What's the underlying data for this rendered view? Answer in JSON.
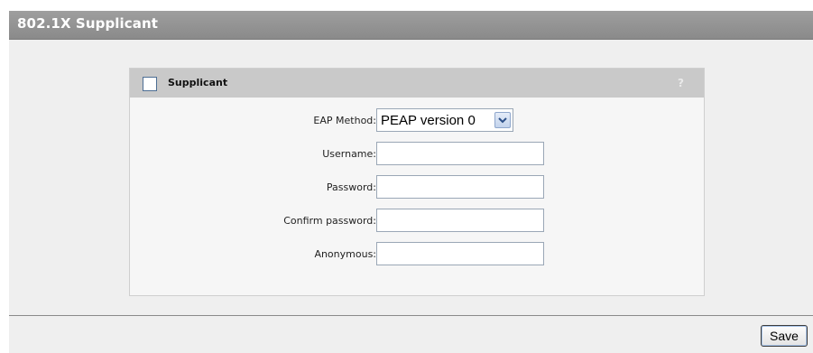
{
  "page": {
    "title": "802.1X Supplicant"
  },
  "panel": {
    "title": "Supplicant",
    "checkbox_checked": false,
    "help": "?",
    "fields": [
      {
        "label": "EAP Method:",
        "type": "select",
        "value": "PEAP version 0"
      },
      {
        "label": "Username:",
        "type": "text",
        "value": ""
      },
      {
        "label": "Password:",
        "type": "password",
        "value": ""
      },
      {
        "label": "Confirm password:",
        "type": "password",
        "value": ""
      },
      {
        "label": "Anonymous:",
        "type": "text",
        "value": ""
      }
    ]
  },
  "footer": {
    "save_label": "Save"
  },
  "colors": {
    "header_bg": "#8f8f8f",
    "panel_header_bg": "#c9c9c9",
    "page_bg": "#efefef"
  }
}
